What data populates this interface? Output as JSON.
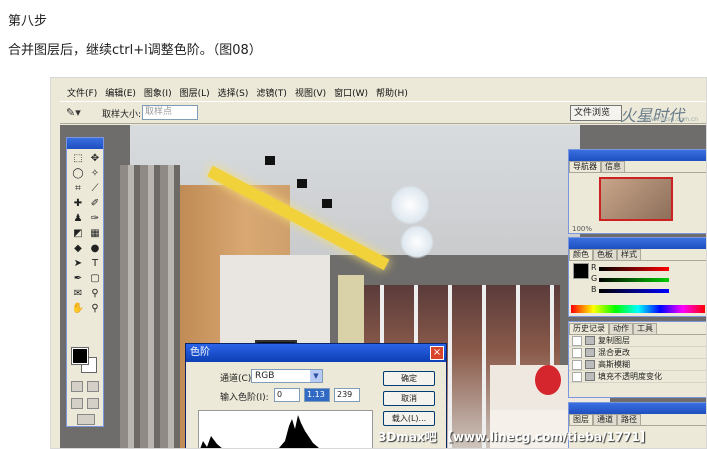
{
  "article": {
    "step_title": "第八步",
    "step_desc": "合并图层后，继续ctrl+l调整色阶。（图08）"
  },
  "photoshop": {
    "menu": [
      "文件(F)",
      "编辑(E)",
      "图象(I)",
      "图层(L)",
      "选择(S)",
      "滤镜(T)",
      "视图(V)",
      "窗口(W)",
      "帮助(H)"
    ],
    "options": {
      "sample_size_label": "取样大小:",
      "sample_size_value": "取样点",
      "file_browser": "文件浏览"
    },
    "logo": {
      "text": "火星时代",
      "url": "www.hxsd.com.cn"
    },
    "navigator": {
      "tabs": [
        "导航器",
        "信息"
      ],
      "zoom": "100%"
    },
    "color": {
      "tabs": [
        "颜色",
        "色板",
        "样式"
      ],
      "channels": [
        "R",
        "G",
        "B"
      ]
    },
    "history": {
      "tabs": [
        "历史记录",
        "动作",
        "工具"
      ],
      "items": [
        "复制图层",
        "混合更改",
        "高斯模糊",
        "填充不透明度变化"
      ]
    },
    "layers": {
      "tabs": [
        "图层",
        "通道",
        "路径"
      ]
    }
  },
  "levels_dialog": {
    "title": "色阶",
    "close": "×",
    "channel_label": "通道(C):",
    "channel_value": "RGB",
    "input_label": "输入色阶(I):",
    "input_black": "0",
    "input_gamma": "1.13",
    "input_white": "239",
    "buttons": {
      "ok": "确定",
      "cancel": "取消",
      "load": "载入(L)..."
    }
  },
  "watermark": "3Dmax吧 【www.linecg.com/tieba/1771】",
  "colors": {
    "xp_title": "#0d3fb4",
    "panel_bg": "#ece9d8",
    "accent_red": "#d4262c"
  }
}
